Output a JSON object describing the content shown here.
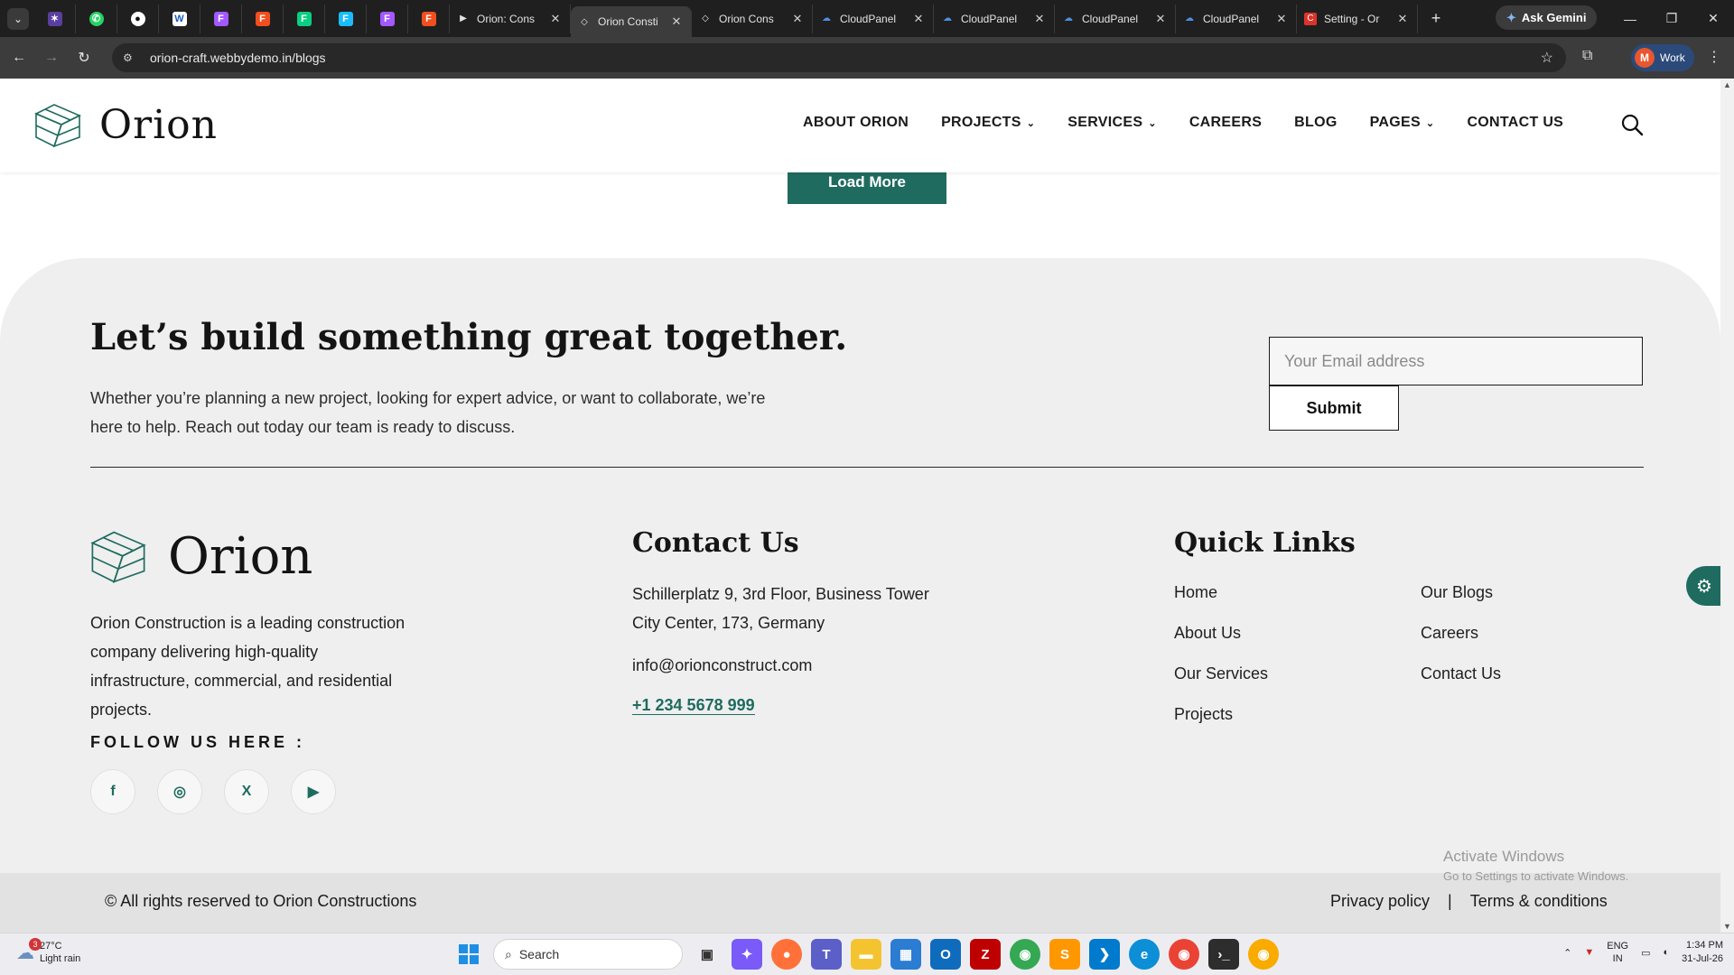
{
  "browser": {
    "tabs": [
      {
        "title": "Orion: Cons",
        "favicon": "play-icon",
        "active": false
      },
      {
        "title": "Orion Consti",
        "favicon": "orion-icon",
        "active": true
      },
      {
        "title": "Orion Cons",
        "favicon": "orion-icon",
        "active": false
      },
      {
        "title": "CloudPanel",
        "favicon": "cloud-icon",
        "active": false
      },
      {
        "title": "CloudPanel",
        "favicon": "cloud-icon",
        "active": false
      },
      {
        "title": "CloudPanel",
        "favicon": "cloud-icon",
        "active": false
      },
      {
        "title": "CloudPanel",
        "favicon": "cloud-icon",
        "active": false
      },
      {
        "title": "Setting - Or",
        "favicon": "c-icon",
        "active": false
      }
    ],
    "gemini_label": "Ask Gemini",
    "url": "orion-craft.webbydemo.in/blogs",
    "profile_label": "Work",
    "profile_initial": "M"
  },
  "header": {
    "logo_text": "Orion",
    "nav": [
      {
        "label": "ABOUT ORION",
        "dropdown": false
      },
      {
        "label": "PROJECTS",
        "dropdown": true
      },
      {
        "label": "SERVICES",
        "dropdown": true
      },
      {
        "label": "CAREERS",
        "dropdown": false
      },
      {
        "label": "BLOG",
        "dropdown": false
      },
      {
        "label": "PAGES",
        "dropdown": true
      },
      {
        "label": "CONTACT US",
        "dropdown": false
      }
    ]
  },
  "load_more_label": "Load More",
  "cta": {
    "title": "Let’s build something great together.",
    "text": "Whether you’re planning a new project, looking for expert advice, or want to collaborate, we’re here to help. Reach out today our team is ready to discuss.",
    "email_placeholder": "Your Email address",
    "submit_label": "Submit"
  },
  "footer": {
    "logo_text": "Orion",
    "about": "Orion Construction is a leading construction company delivering high-quality infrastructure, commercial, and residential projects.",
    "follow_label": "FOLLOW US HERE :",
    "social": [
      {
        "name": "facebook-icon",
        "glyph": "f"
      },
      {
        "name": "instagram-icon",
        "glyph": "◎"
      },
      {
        "name": "x-icon",
        "glyph": "X"
      },
      {
        "name": "youtube-icon",
        "glyph": "▶"
      }
    ],
    "contact": {
      "title": "Contact Us",
      "address_line1": "Schillerplatz 9, 3rd Floor, Business Tower",
      "address_line2": "City Center, 173, Germany",
      "email": "info@orionconstruct.com",
      "phone": "+1 234 5678 999"
    },
    "quick_links": {
      "title": "Quick Links",
      "col1": [
        "Home",
        "About Us",
        "Our Services",
        "Projects"
      ],
      "col2": [
        "Our Blogs",
        "Careers",
        "Contact Us"
      ]
    },
    "copyright": "© All rights reserved to Orion Constructions",
    "legal": [
      "Privacy policy",
      "|",
      "Terms & conditions"
    ]
  },
  "watermark": {
    "line1": "Activate Windows",
    "line2": "Go to Settings to activate Windows."
  },
  "taskbar": {
    "weather_temp": "27°C",
    "weather_desc": "Light rain",
    "weather_badge": "3",
    "search_placeholder": "Search",
    "lang_line1": "ENG",
    "lang_line2": "IN",
    "time": "1:34 PM",
    "date": "31-Jul-26"
  },
  "colors": {
    "accent": "#1f6b5f",
    "footer_bg": "#efefef",
    "bottom_bar": "#e2e2e2"
  }
}
